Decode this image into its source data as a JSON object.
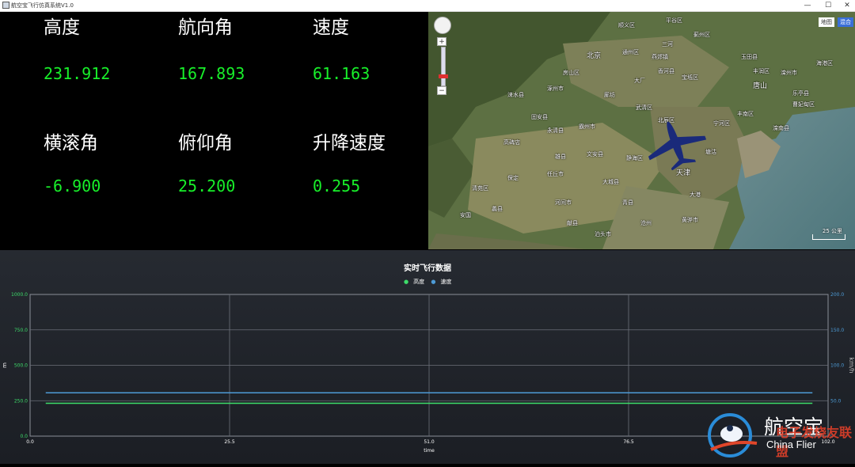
{
  "window": {
    "title": "航空宝飞行仿真系统V1.0",
    "minimize": "—",
    "maximize": "☐",
    "close": "✕"
  },
  "telemetry": {
    "altitude": {
      "label": "高度",
      "value": "231.912"
    },
    "heading": {
      "label": "航向角",
      "value": "167.893"
    },
    "speed": {
      "label": "速度",
      "value": "61.163"
    },
    "roll": {
      "label": "横滚角",
      "value": "-6.900"
    },
    "pitch": {
      "label": "俯仰角",
      "value": "25.200"
    },
    "vspeed": {
      "label": "升降速度",
      "value": "0.255"
    }
  },
  "map": {
    "map_type_map": "地图",
    "map_type_hybrid": "混合",
    "zoom_in": "+",
    "zoom_out": "−",
    "scale_label": "25 公里",
    "cities": [
      "平谷区",
      "顺义区",
      "三河",
      "蓟州区",
      "北京",
      "通州区",
      "燕郊镇",
      "香河县",
      "玉田县",
      "丰润区",
      "唐山",
      "大厂",
      "宝坻区",
      "廊坊",
      "武清区",
      "丰南区",
      "固安县",
      "霸州市",
      "永清县",
      "北辰区",
      "天津",
      "宁河区",
      "滦南县",
      "高碑店",
      "雄县",
      "文安县",
      "静海区",
      "塘沽",
      "大港",
      "保定",
      "清苑区",
      "任丘市",
      "河间市",
      "大城县",
      "青县",
      "黄骅市",
      "献县",
      "沧州",
      "安国",
      "蠡县",
      "泊头市",
      "曹妃甸区",
      "乐亭县",
      "涿州市",
      "涞水县",
      "滦州市",
      "房山区",
      "海港区"
    ],
    "aircraft_color": "#1a2a7a"
  },
  "chart_data": {
    "type": "line",
    "title": "实时飞行数据",
    "xlabel": "time",
    "ylabel_left": "m",
    "ylabel_right": "km/h",
    "x_ticks": [
      "0.0",
      "25.5",
      "51.0",
      "76.5",
      "102.0"
    ],
    "y_left_ticks": [
      "0.0",
      "250.0",
      "500.0",
      "750.0",
      "1000.0"
    ],
    "y_right_ticks": [
      "0",
      "50.0",
      "100.0",
      "150.0",
      "200.0"
    ],
    "xlim": [
      0,
      102
    ],
    "ylim_left": [
      0,
      1000
    ],
    "ylim_right": [
      0,
      200
    ],
    "grid": true,
    "legend_placement": "top-center",
    "series": [
      {
        "name": "高度",
        "axis": "left",
        "color": "#3ddc6a",
        "x": [
          2,
          100
        ],
        "values": [
          231.9,
          231.9
        ]
      },
      {
        "name": "速度",
        "axis": "right",
        "color": "#4d9bd6",
        "x": [
          2,
          100
        ],
        "values": [
          61.2,
          61.2
        ]
      }
    ]
  },
  "watermark": {
    "brand": "航空宝",
    "overlay_brand": "电子发烧友联盟",
    "site": "China Flier"
  }
}
